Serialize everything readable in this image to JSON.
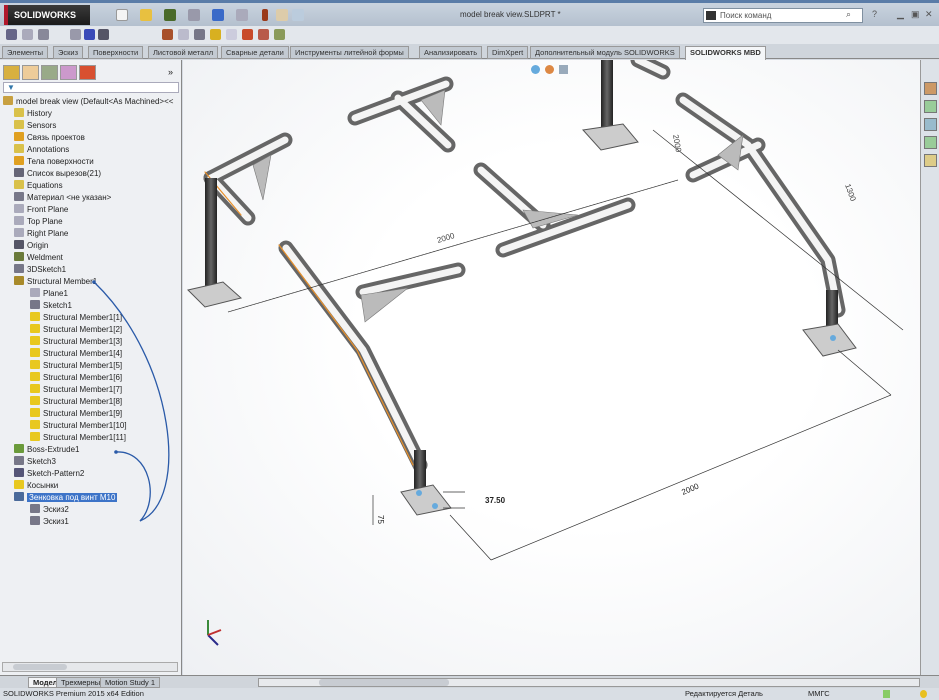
{
  "app": {
    "logo": "SOLIDWORKS",
    "doc_title": "model break view.SLDPRT *",
    "search_placeholder": "Поиск команд"
  },
  "tabs": [
    "Элементы",
    "Эскиз",
    "Поверхности",
    "Листовой металл",
    "Сварные детали",
    "Инструменты литейной формы",
    "Анализировать",
    "DimXpert",
    "Дополнительный модуль SOLIDWORKS",
    "SOLIDWORKS MBD"
  ],
  "tree": {
    "filter": "▼",
    "root": "model break view  (Default<As Machined><<",
    "items": [
      {
        "label": "History",
        "indent": 1,
        "color": "#d9c14a"
      },
      {
        "label": "Sensors",
        "indent": 1,
        "color": "#d9c14a"
      },
      {
        "label": "Связь проектов",
        "indent": 1,
        "color": "#e0a020"
      },
      {
        "label": "Annotations",
        "indent": 1,
        "color": "#d9c14a"
      },
      {
        "label": "Тела поверхности",
        "indent": 1,
        "color": "#e0a020"
      },
      {
        "label": "Список вырезов(21)",
        "indent": 1,
        "color": "#667"
      },
      {
        "label": "Equations",
        "indent": 1,
        "color": "#d9c14a"
      },
      {
        "label": "Материал <не указан>",
        "indent": 1,
        "color": "#778"
      },
      {
        "label": "Front Plane",
        "indent": 1,
        "color": "#aab"
      },
      {
        "label": "Top Plane",
        "indent": 1,
        "color": "#aab"
      },
      {
        "label": "Right Plane",
        "indent": 1,
        "color": "#aab"
      },
      {
        "label": "Origin",
        "indent": 1,
        "color": "#556"
      },
      {
        "label": "Weldment",
        "indent": 1,
        "color": "#6a7a3a"
      },
      {
        "label": "3DSketch1",
        "indent": 1,
        "color": "#778"
      },
      {
        "label": "Structural Member1",
        "indent": 1,
        "color": "#a88a2a"
      },
      {
        "label": "Plane1",
        "indent": 2,
        "color": "#aab"
      },
      {
        "label": "Sketch1",
        "indent": 2,
        "color": "#778"
      },
      {
        "label": "Structural Member1[1]",
        "indent": 2,
        "color": "#e8c820"
      },
      {
        "label": "Structural Member1[2]",
        "indent": 2,
        "color": "#e8c820"
      },
      {
        "label": "Structural Member1[3]",
        "indent": 2,
        "color": "#e8c820"
      },
      {
        "label": "Structural Member1[4]",
        "indent": 2,
        "color": "#e8c820"
      },
      {
        "label": "Structural Member1[5]",
        "indent": 2,
        "color": "#e8c820"
      },
      {
        "label": "Structural Member1[6]",
        "indent": 2,
        "color": "#e8c820"
      },
      {
        "label": "Structural Member1[7]",
        "indent": 2,
        "color": "#e8c820"
      },
      {
        "label": "Structural Member1[8]",
        "indent": 2,
        "color": "#e8c820"
      },
      {
        "label": "Structural Member1[9]",
        "indent": 2,
        "color": "#e8c820"
      },
      {
        "label": "Structural Member1[10]",
        "indent": 2,
        "color": "#e8c820"
      },
      {
        "label": "Structural Member1[11]",
        "indent": 2,
        "color": "#e8c820"
      },
      {
        "label": "Boss-Extrude1",
        "indent": 1,
        "color": "#6a9a3a"
      },
      {
        "label": "Sketch3",
        "indent": 1,
        "color": "#778"
      },
      {
        "label": "Sketch-Pattern2",
        "indent": 1,
        "color": "#557"
      },
      {
        "label": "Косынки",
        "indent": 1,
        "color": "#e8c820"
      },
      {
        "label": "Зенковка под винт M10",
        "indent": 1,
        "color": "#4a6a9a",
        "selected": true
      },
      {
        "label": "Эскиз2",
        "indent": 2,
        "color": "#778"
      },
      {
        "label": "Эскиз1",
        "indent": 2,
        "color": "#778"
      }
    ]
  },
  "dimensions": {
    "d1": "2000",
    "d2": "2000",
    "d3": "2000",
    "d4": "1300",
    "d5": "75",
    "d6": "37.50"
  },
  "bottom_tabs": [
    "Модель",
    "Трехмерные виды",
    "Motion Study 1"
  ],
  "status": {
    "edition": "SOLIDWORKS Premium 2015 x64 Edition",
    "mode": "Редактируется Деталь",
    "units": "ММГС"
  },
  "colors": {
    "accent": "#3d74c8",
    "selection": "#e8902a"
  }
}
